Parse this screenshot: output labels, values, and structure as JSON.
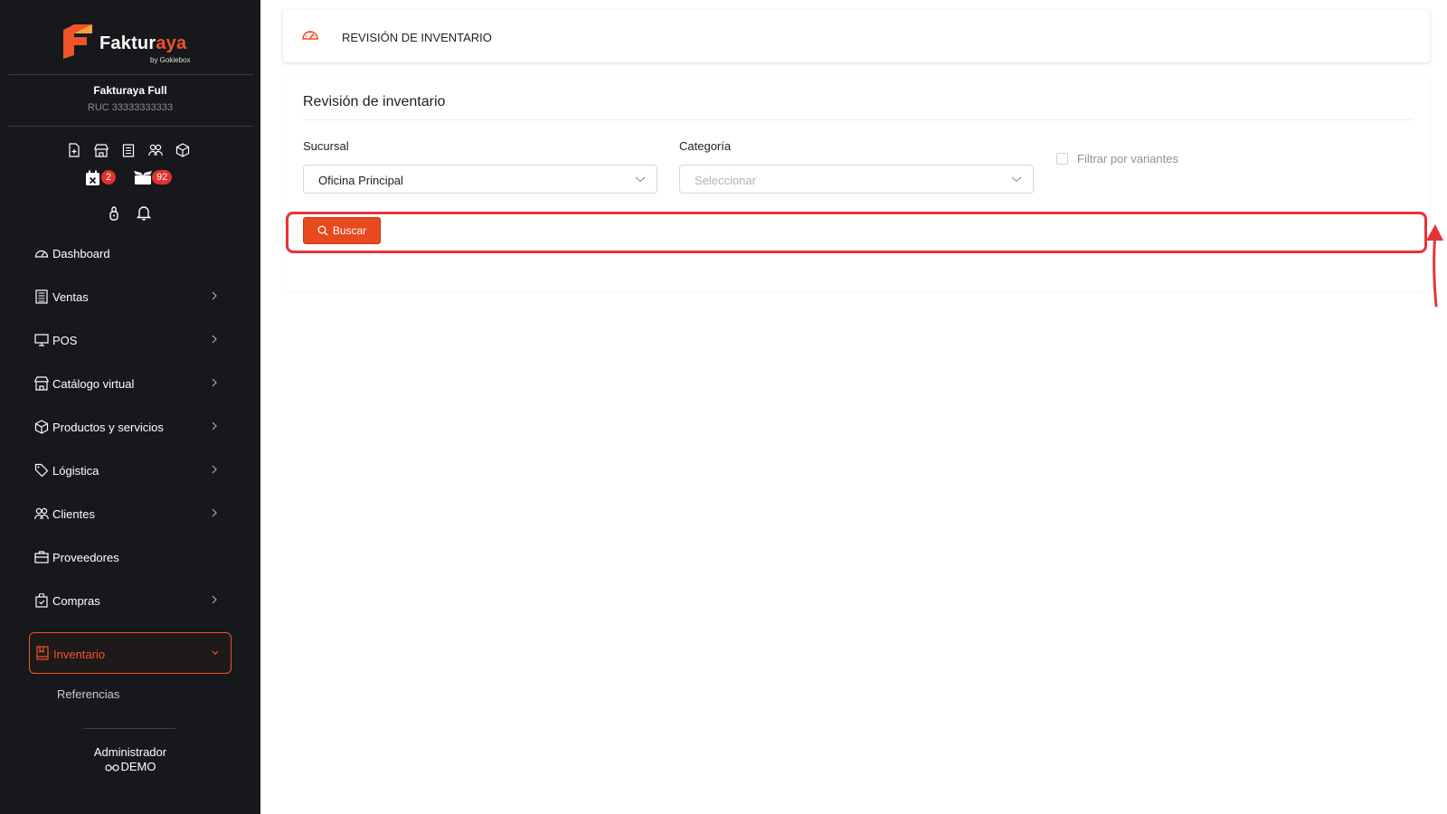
{
  "brand": {
    "name_main": "Faktur",
    "name_accent": "aya",
    "byline": "by Gokiebox",
    "accent_color": "#f0542a"
  },
  "company": {
    "name": "Fakturaya Full",
    "ruc": "RUC 33333333333"
  },
  "badges": {
    "calendar_count": "2",
    "box_count": "92"
  },
  "nav": {
    "items": [
      {
        "label": "Dashboard",
        "icon": "dashboard-icon"
      },
      {
        "label": "Ventas",
        "icon": "ventas-icon"
      },
      {
        "label": "POS",
        "icon": "monitor-icon"
      },
      {
        "label": "Catálogo virtual",
        "icon": "store-icon"
      },
      {
        "label": "Productos y servicios",
        "icon": "box-icon"
      },
      {
        "label": "Lógistica",
        "icon": "tag-icon"
      },
      {
        "label": "Clientes",
        "icon": "users-icon"
      },
      {
        "label": "Proveedores",
        "icon": "briefcase-icon"
      },
      {
        "label": "Compras",
        "icon": "bag-icon"
      },
      {
        "label": "Inventario",
        "icon": "book-icon",
        "active": true
      }
    ],
    "sub_items": [
      "Referencias"
    ]
  },
  "user": {
    "role": "Administrador",
    "name": "DEMO"
  },
  "header": {
    "title": "REVISIÓN DE INVENTARIO"
  },
  "form": {
    "title": "Revisión de inventario",
    "sucursal_label": "Sucursal",
    "sucursal_value": "Oficina Principal",
    "categoria_label": "Categoría",
    "categoria_placeholder": "Seleccionar",
    "variantes_label": "Filtrar por variantes",
    "search_button": "Buscar"
  },
  "colors": {
    "sidebar_bg": "#16181c",
    "button_bg": "#e8491e",
    "highlight": "#e8333a",
    "badge": "#e1322d"
  }
}
